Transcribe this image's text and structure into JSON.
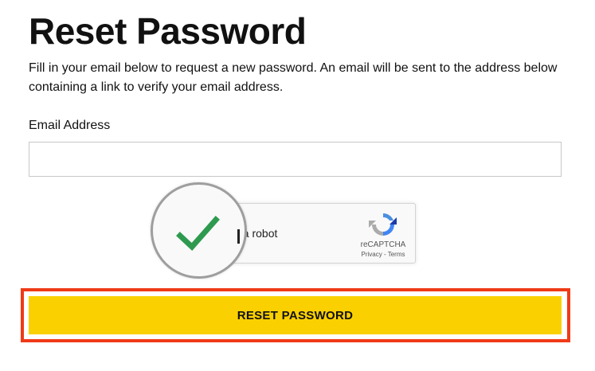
{
  "page": {
    "title": "Reset Password",
    "description": "Fill in your email below to request a new password. An email will be sent to the address below containing a link to verify your email address."
  },
  "form": {
    "email_label": "Email Address",
    "email_value": "",
    "email_placeholder": "",
    "recaptcha": {
      "label": "I'm not a robot",
      "label_visible": "t a robot",
      "checked": true,
      "brand": "reCAPTCHA",
      "privacy_link": "Privacy",
      "separator": " - ",
      "terms_link": "Terms"
    },
    "submit_label": "RESET PASSWORD"
  },
  "colors": {
    "button": "#fbd000",
    "highlight": "#f03a17",
    "checkmark": "#2e9a4f"
  },
  "icons": {
    "checkmark": "checkmark-icon",
    "recaptcha_logo": "recaptcha-logo-icon"
  }
}
